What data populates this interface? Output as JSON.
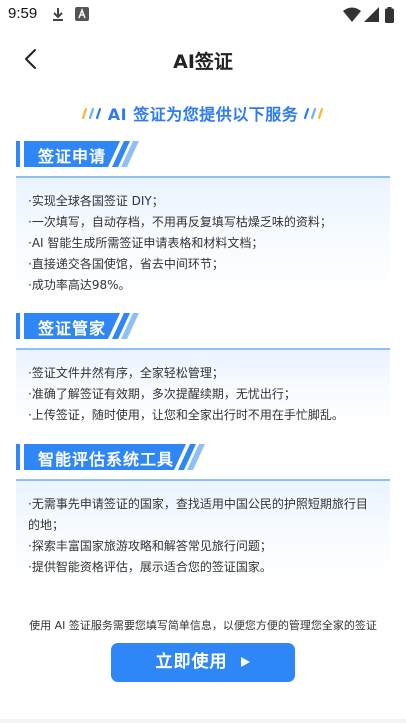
{
  "status": {
    "time": "9:59"
  },
  "nav": {
    "title": "AI签证"
  },
  "banner": {
    "text": "AI 签证为您提供以下服务"
  },
  "sections": [
    {
      "title": "签证申请",
      "items": [
        "·实现全球各国签证 DIY；",
        "·一次填写，自动存档，不用再反复填写枯燥乏味的资料；",
        "·AI 智能生成所需签证申请表格和材料文档；",
        "·直接递交各国使馆，省去中间环节；",
        "·成功率高达98%。"
      ]
    },
    {
      "title": "签证管家",
      "items": [
        "·签证文件井然有序，全家轻松管理；",
        "·准确了解签证有效期，多次提醒续期，无忧出行；",
        "·上传签证，随时使用，让您和全家出行时不用在手忙脚乱。"
      ]
    },
    {
      "title": "智能评估系统工具",
      "items": [
        "·无需事先申请签证的国家，查找适用中国公民的护照短期旅行目的地；",
        "·探索丰富国家旅游攻略和解答常见旅行问题；",
        "·提供智能资格评估，展示适合您的签证国家。"
      ]
    }
  ],
  "footer": {
    "note": "使用 AI 签证服务需要您填写简单信息，以便您方便的管理您全家的签证",
    "button_label": "立即使用"
  },
  "colors": {
    "accent": "#2f86f6",
    "banner": "#2f7bf0",
    "header_fill": "#2f86f6"
  },
  "icons": [
    "download-icon",
    "app-icon",
    "wifi-icon",
    "signal-icon",
    "battery-icon",
    "back-arrow-icon",
    "play-icon"
  ]
}
